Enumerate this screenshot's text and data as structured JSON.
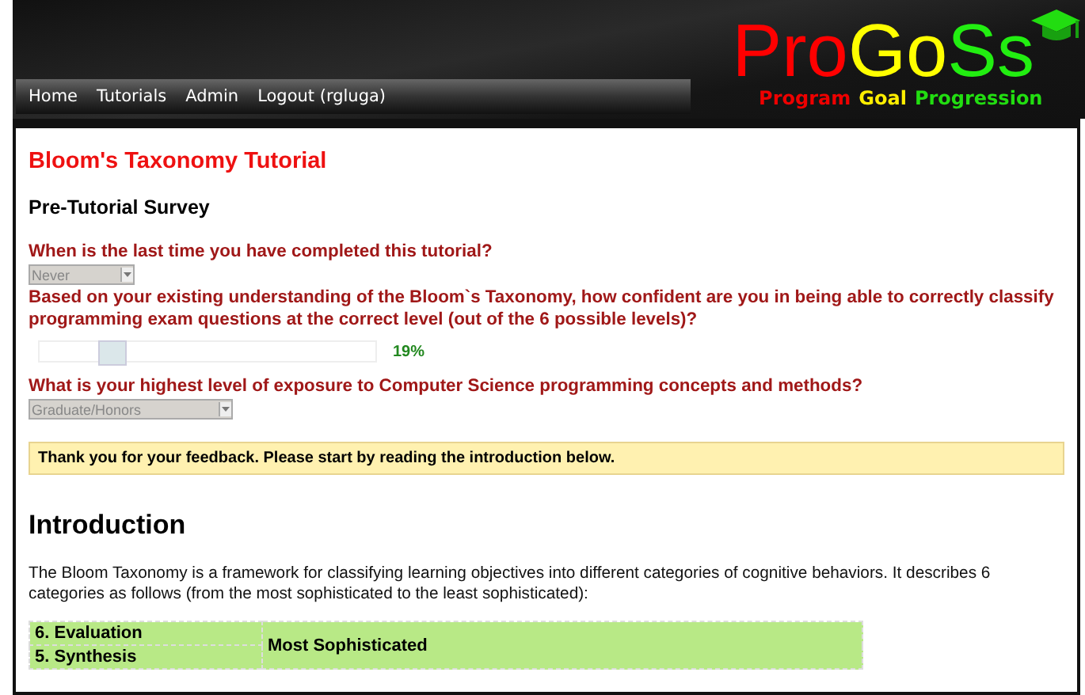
{
  "nav": [
    {
      "label": "Home"
    },
    {
      "label": "Tutorials"
    },
    {
      "label": "Admin"
    },
    {
      "label": "Logout (rgluga)"
    }
  ],
  "logo": {
    "parts": [
      {
        "text": "Pro",
        "color": "#ff0000"
      },
      {
        "text": "Go",
        "color": "#ffff00"
      },
      {
        "text": "Ss",
        "color": "#22ee11"
      }
    ],
    "tagline": [
      {
        "text": "Program",
        "color": "#ee0000"
      },
      {
        "text": "Goal",
        "color": "#ffee00"
      },
      {
        "text": "Progression",
        "color": "#22dd11"
      }
    ]
  },
  "title": "Bloom's Taxonomy Tutorial",
  "survey": {
    "heading": "Pre-Tutorial Survey",
    "questions": [
      {
        "kind": "select",
        "text": "When is the last time you have completed this tutorial?",
        "value": "Never",
        "disabled": true
      },
      {
        "kind": "slider",
        "text": "Based on your existing understanding of the Bloom`s Taxonomy, how confident are you in being able to correctly classify programming exam questions at the correct level (out of the 6 possible levels)?",
        "level": 0.19,
        "reading": "19%"
      },
      {
        "kind": "select",
        "text": "What is your highest level of exposure to Computer Science programming concepts and methods?",
        "value": "Graduate/Honors",
        "disabled": true
      }
    ]
  },
  "notice": "Thank you for your feedback. Please start by reading the introduction below.",
  "intro": {
    "heading": "Introduction",
    "text": "The Bloom Taxonomy is a framework for classifying learning objectives into different categories of cognitive behaviors. It describes 6 categories as follows (from the most sophisticated to the least sophisticated):"
  },
  "table": {
    "groups": [
      {
        "color": "#b8e986",
        "label": "Most Sophisticated",
        "rows": [
          "6. Evaluation",
          "5. Synthesis"
        ]
      }
    ]
  }
}
